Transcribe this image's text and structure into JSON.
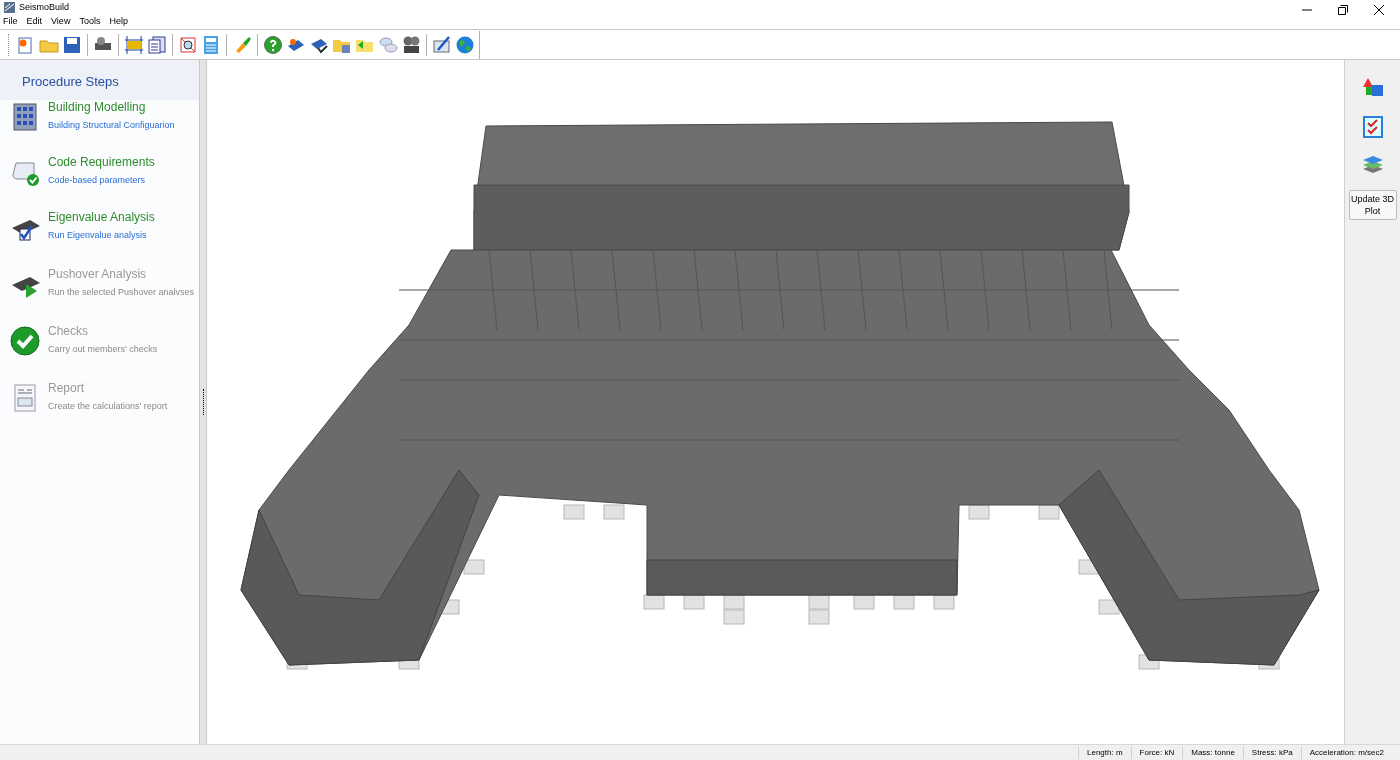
{
  "window": {
    "title": "SeismoBuild"
  },
  "menu": [
    "File",
    "Edit",
    "View",
    "Tools",
    "Help"
  ],
  "sidebar": {
    "title": "Procedure Steps",
    "steps": [
      {
        "title": "Building Modelling",
        "subtitle": "Building Structural Configuarion",
        "disabled": false
      },
      {
        "title": "Code Requirements",
        "subtitle": "Code-based parameters",
        "disabled": false
      },
      {
        "title": "Eigenvalue Analysis",
        "subtitle": "Run Eigenvalue analysis",
        "disabled": false
      },
      {
        "title": "Pushover Analysis",
        "subtitle": "Run the selected Pushover analvses",
        "disabled": true
      },
      {
        "title": "Checks",
        "subtitle": "Carry out members' checks",
        "disabled": true
      },
      {
        "title": "Report",
        "subtitle": "Create the calculations' report",
        "disabled": true
      }
    ]
  },
  "right_panel": {
    "button": "Update 3D Plot"
  },
  "status_bar": [
    "Length: m",
    "Force: kN",
    "Mass: tonne",
    "Stress: kPa",
    "Acceleration: m/sec2"
  ]
}
